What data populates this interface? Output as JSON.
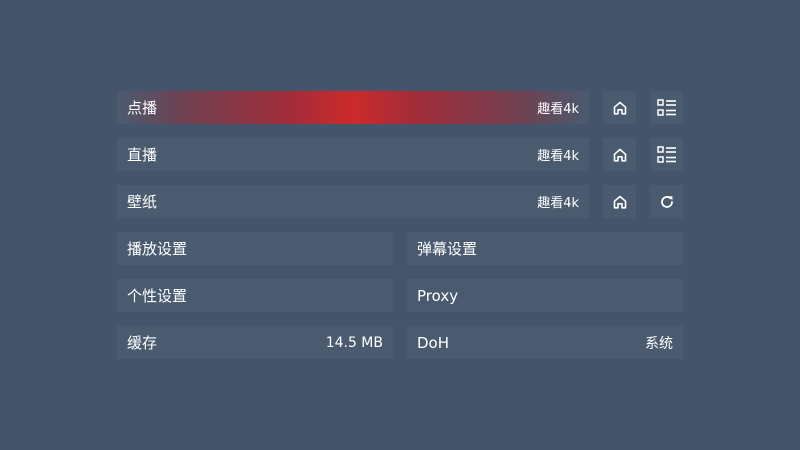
{
  "colors": {
    "background": "#44546a",
    "item_background": "#4a5b70",
    "focus_accent": "#cc2a2a",
    "text": "#ffffff"
  },
  "sources": [
    {
      "label": "点播",
      "site": "趣看4k",
      "focused": true,
      "icons": [
        "home-icon",
        "grid-list-icon"
      ]
    },
    {
      "label": "直播",
      "site": "趣看4k",
      "focused": false,
      "icons": [
        "home-icon",
        "grid-list-icon"
      ]
    },
    {
      "label": "壁纸",
      "site": "趣看4k",
      "focused": false,
      "icons": [
        "home-icon",
        "refresh-icon"
      ]
    }
  ],
  "settings": {
    "playback_settings": "播放设置",
    "danmaku_settings": "弹幕设置",
    "personalization": "个性设置",
    "proxy": "Proxy",
    "cache_label": "缓存",
    "cache_value": "14.5 MB",
    "doh_label": "DoH",
    "doh_value": "系统"
  }
}
